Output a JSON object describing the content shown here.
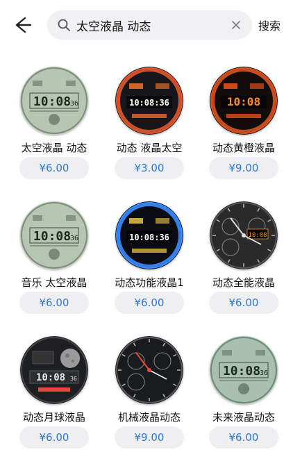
{
  "header": {
    "search_query": "太空液晶 动态",
    "search_button": "搜索"
  },
  "colors": {
    "price_text": "#2a78d8",
    "price_pill_bg": "#efeff1",
    "search_bg": "#f1f1f3"
  },
  "watchfaces": [
    {
      "title": "太空液晶 动态",
      "price": "¥6.00",
      "time": "10:08",
      "seconds": "36",
      "style": "lcd-green"
    },
    {
      "title": "动态 液晶太空",
      "price": "¥3.00",
      "time": "10:08:36",
      "seconds": "",
      "style": "space-orange"
    },
    {
      "title": "动态黄橙液晶",
      "price": "¥9.00",
      "time": "10:08",
      "seconds": "",
      "style": "orange-dark"
    },
    {
      "title": "音乐 太空液晶",
      "price": "¥6.00",
      "time": "10:08",
      "seconds": "36",
      "style": "lcd-green"
    },
    {
      "title": "动态功能液晶1",
      "price": "¥6.00",
      "time": "10:08:36",
      "seconds": "",
      "style": "rainbow-dark"
    },
    {
      "title": "动态全能液晶",
      "price": "¥6.00",
      "time": "10:08",
      "seconds": "",
      "style": "analog-dark"
    },
    {
      "title": "动态月球液晶",
      "price": "¥6.00",
      "time": "10:08",
      "seconds": "36",
      "style": "moon-dark"
    },
    {
      "title": "机械液晶动态",
      "price": "¥9.00",
      "time": "",
      "seconds": "",
      "style": "mech-dark"
    },
    {
      "title": "未来液晶动态",
      "price": "¥6.00",
      "time": "10:08",
      "seconds": "36",
      "style": "future-green"
    }
  ]
}
